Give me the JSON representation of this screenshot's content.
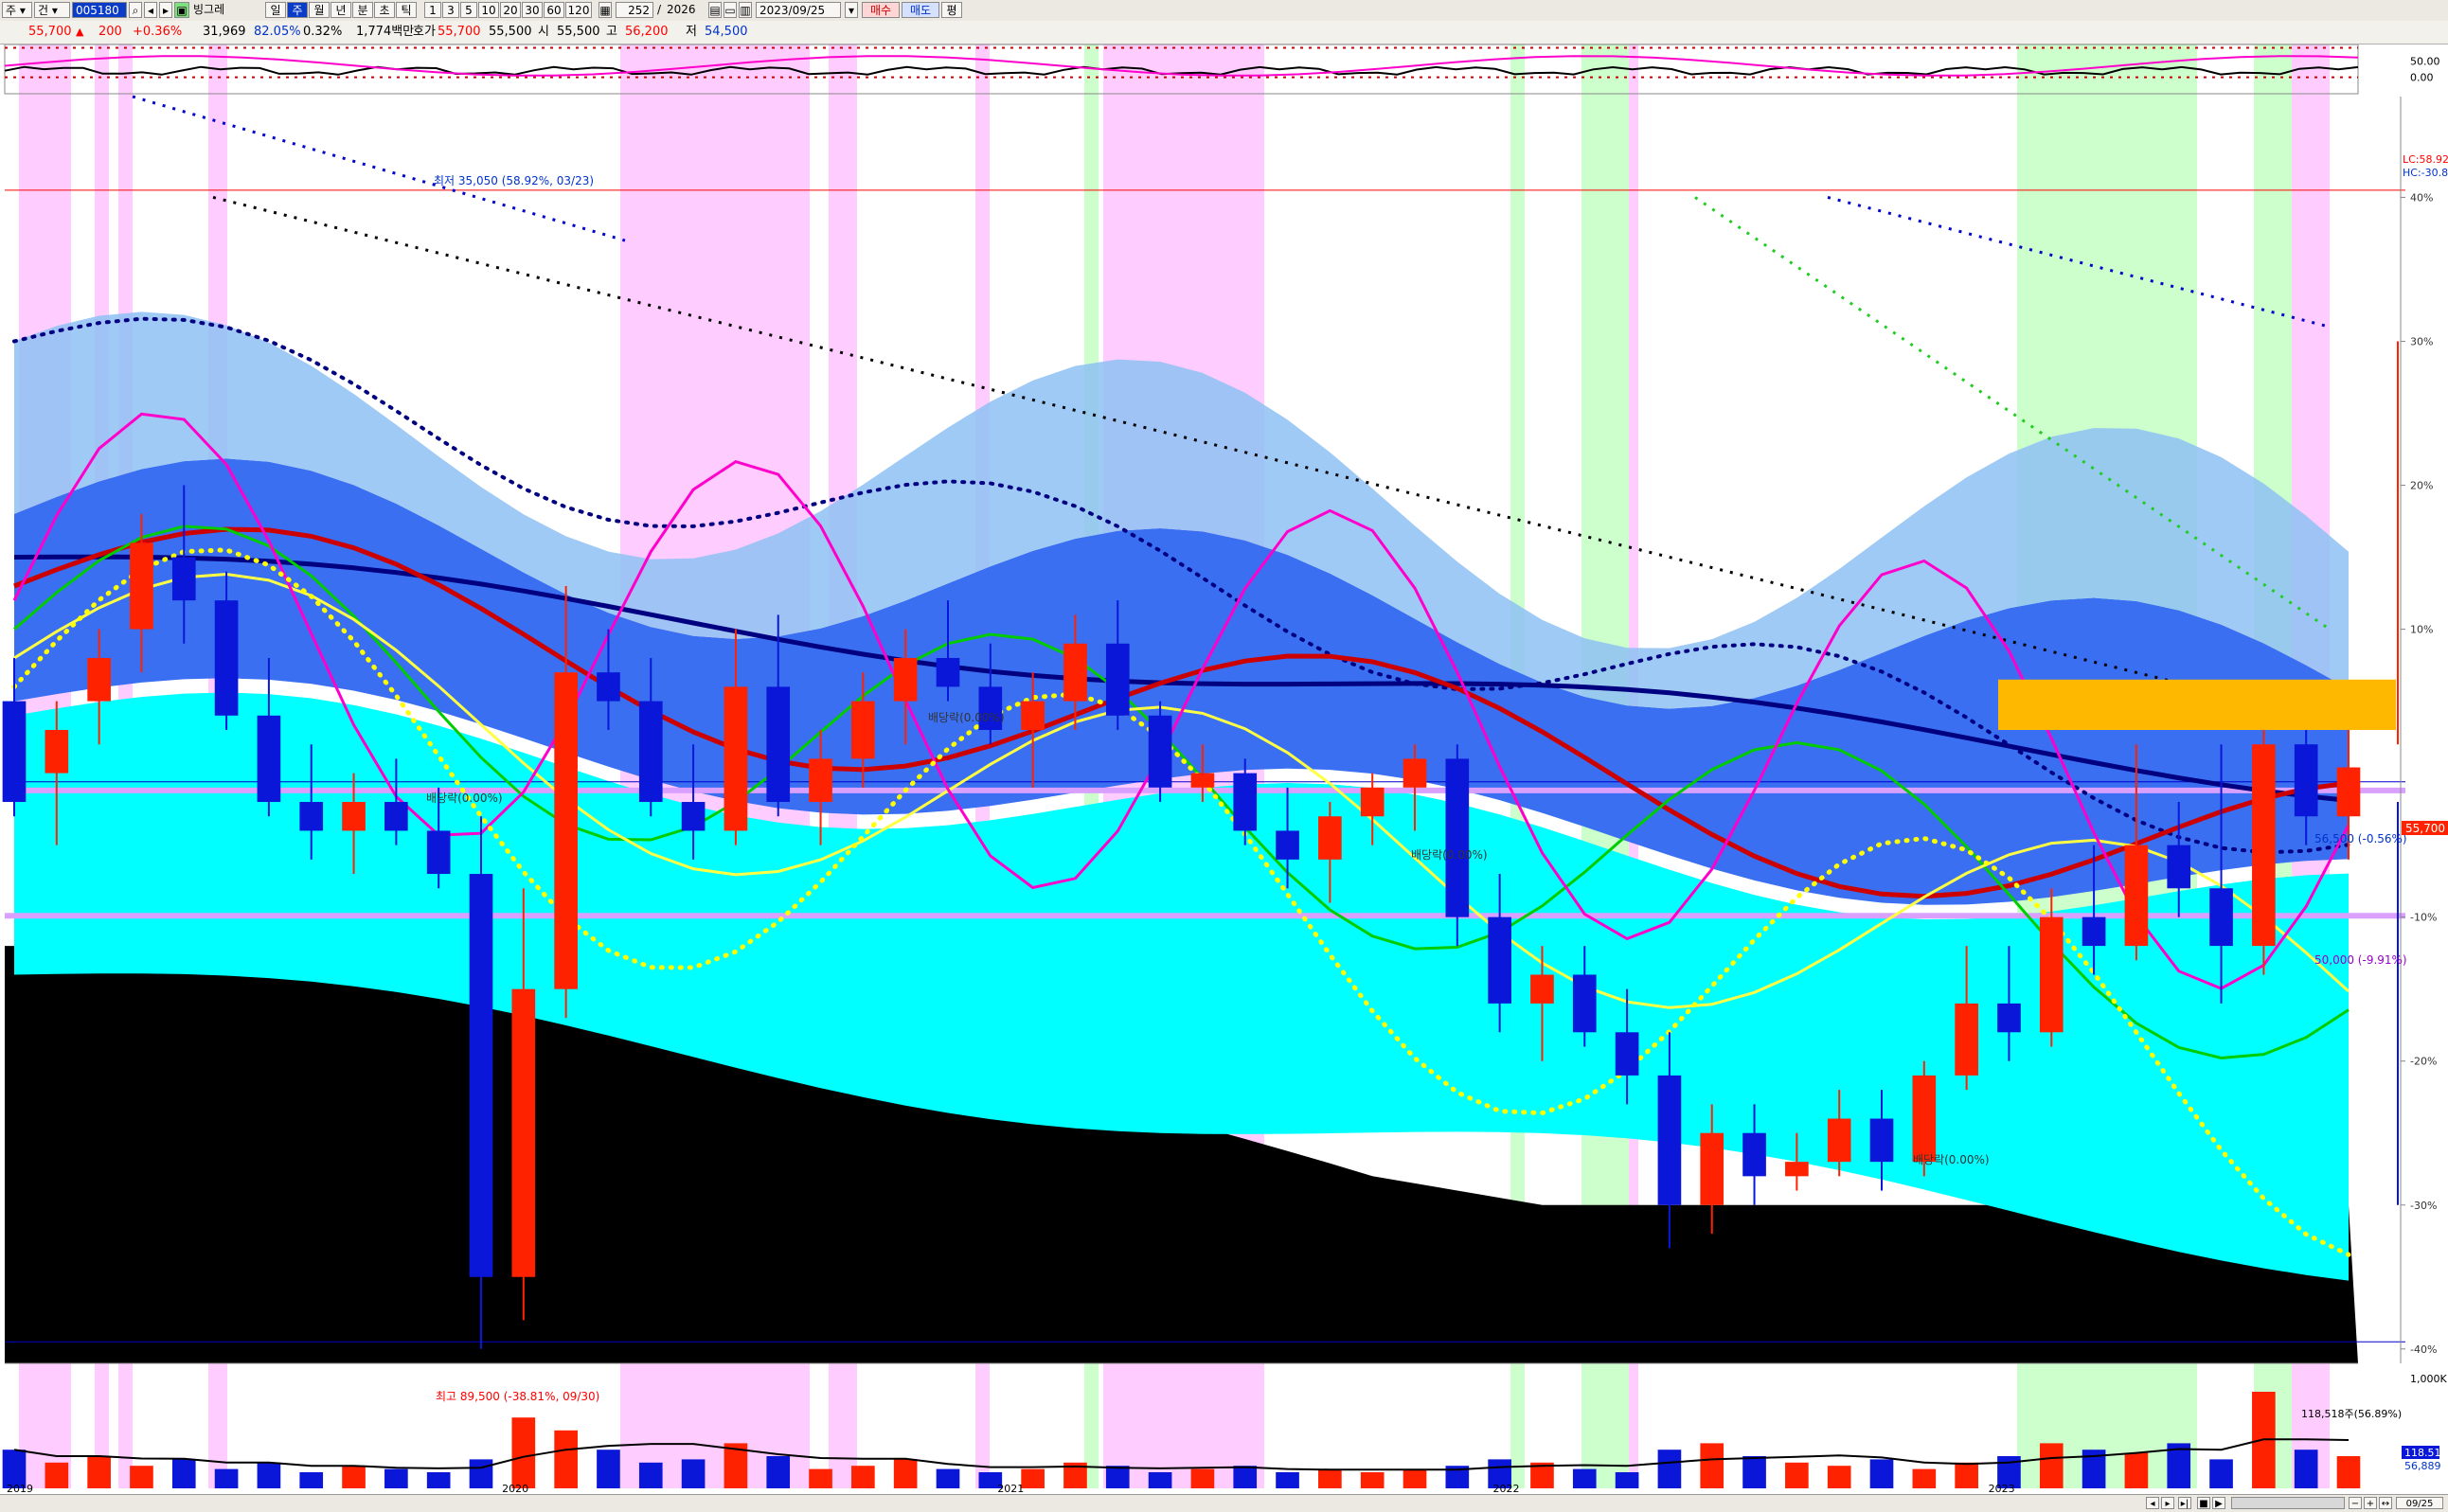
{
  "toolbar": {
    "market_label": "주",
    "item_label": "건",
    "code_value": "005180",
    "chart_name": "빙그레",
    "period_buttons": [
      "일",
      "주",
      "월",
      "년",
      "분",
      "초",
      "틱"
    ],
    "minute_buttons": [
      "1",
      "3",
      "5",
      "10",
      "20",
      "30",
      "60",
      "120"
    ],
    "count_value": "252",
    "count_total": "2026",
    "date_value": "2023/09/25",
    "buy_label": "매수",
    "sell_label": "매도",
    "extra_label": "평"
  },
  "quote": {
    "price": "55,700",
    "change_arrow": "▲",
    "change": "200",
    "change_pct": "+0.36%",
    "volume": "31,969",
    "volume_ratio": "82.05%",
    "turnover": "0.32%",
    "amount_label": "1,774백만",
    "ask_label": "호가",
    "ask_value": "55,700",
    "open_value": "55,500",
    "open_label": "시",
    "high_label": "고",
    "high_value": "56,200",
    "low_label": "저",
    "low_value": "54,500"
  },
  "colors": {
    "up": "#ff2200",
    "down": "#0a17d8",
    "ma_short": "#ff00cc",
    "ma_mid": "#00cc00",
    "ma_long": "#cc0000",
    "ma_year": "#000080",
    "cloud_top": "#3a6ff2",
    "cloud_light": "#8ec1f3",
    "cyan_band": "#00ffff",
    "bottom_band": "#000000",
    "green_bg": "#ccffcc",
    "pink_bg": "#ffccff",
    "dotted_yellow": "#ffff00"
  },
  "annotations": {
    "high_label": "최저 35,050 (58.92%, 03/23)",
    "low_label": "최고 89,500 (-38.81%, 09/30)",
    "ex_dividend_1": "배당락(0.00%)",
    "ex_dividend_2": "배당락(0.00%)",
    "ex_dividend_3": "배당락(0.00%)",
    "ex_dividend_4": "배당락(0.00%)",
    "cur_price_label": "55,700",
    "upper_line_label": "56,500 (-0.56%)",
    "lower_line_label": "50,000 (-9.91%)",
    "lc_label": "LC:58.92",
    "hc_label": "HC:-30.8",
    "vol_label": "118,518주(56.89%)",
    "vol_axis_value": "118.51",
    "vol_axis_value2": "56,889"
  },
  "chart_data": [
    {
      "type": "line",
      "name": "oscillator",
      "y_ticks": [
        "50.00",
        "0.00"
      ],
      "ylim": [
        -50,
        100
      ]
    },
    {
      "type": "candlestick",
      "name": "price",
      "x_labels": [
        "2019",
        "2020",
        "2021",
        "2022",
        "2023"
      ],
      "last_date_label": "09/25",
      "y_ticks": [
        "40%",
        "30%",
        "20%",
        "10%",
        "-10%",
        "-20%",
        "-30%",
        "-40%"
      ],
      "y_unit": "% from current price",
      "current_price": 55700,
      "ylim_pct": [
        -41,
        47
      ],
      "ohlc": [
        {
          "t": 0,
          "o": 5,
          "h": 8,
          "l": -3,
          "c": -2
        },
        {
          "t": 1,
          "o": 0,
          "h": 5,
          "l": -5,
          "c": 3
        },
        {
          "t": 2,
          "o": 5,
          "h": 10,
          "l": 2,
          "c": 8
        },
        {
          "t": 3,
          "o": 10,
          "h": 18,
          "l": 7,
          "c": 16
        },
        {
          "t": 4,
          "o": 15,
          "h": 20,
          "l": 9,
          "c": 12
        },
        {
          "t": 5,
          "o": 12,
          "h": 14,
          "l": 3,
          "c": 4
        },
        {
          "t": 6,
          "o": 4,
          "h": 8,
          "l": -3,
          "c": -2
        },
        {
          "t": 7,
          "o": -2,
          "h": 2,
          "l": -6,
          "c": -4
        },
        {
          "t": 8,
          "o": -4,
          "h": 0,
          "l": -7,
          "c": -2
        },
        {
          "t": 9,
          "o": -2,
          "h": 1,
          "l": -5,
          "c": -4
        },
        {
          "t": 10,
          "o": -4,
          "h": -1,
          "l": -8,
          "c": -7
        },
        {
          "t": 11,
          "o": -7,
          "h": -3,
          "l": -40,
          "c": -35
        },
        {
          "t": 12,
          "o": -35,
          "h": -8,
          "l": -38,
          "c": -15
        },
        {
          "t": 13,
          "o": -15,
          "h": 13,
          "l": -17,
          "c": 7
        },
        {
          "t": 14,
          "o": 7,
          "h": 10,
          "l": 3,
          "c": 5
        },
        {
          "t": 15,
          "o": 5,
          "h": 8,
          "l": -3,
          "c": -2
        },
        {
          "t": 16,
          "o": -2,
          "h": 2,
          "l": -6,
          "c": -4
        },
        {
          "t": 17,
          "o": -4,
          "h": 10,
          "l": -5,
          "c": 6
        },
        {
          "t": 18,
          "o": 6,
          "h": 11,
          "l": -3,
          "c": -2
        },
        {
          "t": 19,
          "o": -2,
          "h": 3,
          "l": -5,
          "c": 1
        },
        {
          "t": 20,
          "o": 1,
          "h": 7,
          "l": -1,
          "c": 5
        },
        {
          "t": 21,
          "o": 5,
          "h": 10,
          "l": 2,
          "c": 8
        },
        {
          "t": 22,
          "o": 8,
          "h": 12,
          "l": 5,
          "c": 6
        },
        {
          "t": 23,
          "o": 6,
          "h": 9,
          "l": 2,
          "c": 3
        },
        {
          "t": 24,
          "o": 3,
          "h": 7,
          "l": -1,
          "c": 5
        },
        {
          "t": 25,
          "o": 5,
          "h": 11,
          "l": 3,
          "c": 9
        },
        {
          "t": 26,
          "o": 9,
          "h": 12,
          "l": 3,
          "c": 4
        },
        {
          "t": 27,
          "o": 4,
          "h": 5,
          "l": -2,
          "c": -1
        },
        {
          "t": 28,
          "o": -1,
          "h": 2,
          "l": -2,
          "c": 0
        },
        {
          "t": 29,
          "o": 0,
          "h": 1,
          "l": -5,
          "c": -4
        },
        {
          "t": 30,
          "o": -4,
          "h": -1,
          "l": -8,
          "c": -6
        },
        {
          "t": 31,
          "o": -6,
          "h": -2,
          "l": -9,
          "c": -3
        },
        {
          "t": 32,
          "o": -3,
          "h": 0,
          "l": -5,
          "c": -1
        },
        {
          "t": 33,
          "o": -1,
          "h": 2,
          "l": -4,
          "c": 1
        },
        {
          "t": 34,
          "o": 1,
          "h": 2,
          "l": -12,
          "c": -10
        },
        {
          "t": 35,
          "o": -10,
          "h": -7,
          "l": -18,
          "c": -16
        },
        {
          "t": 36,
          "o": -16,
          "h": -12,
          "l": -20,
          "c": -14
        },
        {
          "t": 37,
          "o": -14,
          "h": -12,
          "l": -19,
          "c": -18
        },
        {
          "t": 38,
          "o": -18,
          "h": -15,
          "l": -23,
          "c": -21
        },
        {
          "t": 39,
          "o": -21,
          "h": -18,
          "l": -33,
          "c": -30
        },
        {
          "t": 40,
          "o": -30,
          "h": -23,
          "l": -32,
          "c": -25
        },
        {
          "t": 41,
          "o": -25,
          "h": -23,
          "l": -30,
          "c": -28
        },
        {
          "t": 42,
          "o": -28,
          "h": -25,
          "l": -29,
          "c": -27
        },
        {
          "t": 43,
          "o": -27,
          "h": -22,
          "l": -28,
          "c": -24
        },
        {
          "t": 44,
          "o": -24,
          "h": -22,
          "l": -29,
          "c": -27
        },
        {
          "t": 45,
          "o": -27,
          "h": -20,
          "l": -28,
          "c": -21
        },
        {
          "t": 46,
          "o": -21,
          "h": -12,
          "l": -22,
          "c": -16
        },
        {
          "t": 47,
          "o": -16,
          "h": -12,
          "l": -20,
          "c": -18
        },
        {
          "t": 48,
          "o": -18,
          "h": -8,
          "l": -19,
          "c": -10
        },
        {
          "t": 49,
          "o": -10,
          "h": -5,
          "l": -14,
          "c": -12
        },
        {
          "t": 50,
          "o": -12,
          "h": 2,
          "l": -13,
          "c": -5
        },
        {
          "t": 51,
          "o": -5,
          "h": -2,
          "l": -10,
          "c": -8
        },
        {
          "t": 52,
          "o": -8,
          "h": 2,
          "l": -16,
          "c": -12
        },
        {
          "t": 53,
          "o": -12,
          "h": 4,
          "l": -14,
          "c": 2
        },
        {
          "t": 54,
          "o": 2,
          "h": 4,
          "l": -5,
          "c": -3
        },
        {
          "t": 55,
          "o": -3,
          "h": 3,
          "l": -6,
          "c": 0.4
        }
      ]
    },
    {
      "type": "bar",
      "name": "volume",
      "y_ticks": [
        "1,000K"
      ],
      "values": [
        12,
        8,
        10,
        7,
        9,
        6,
        8,
        5,
        7,
        6,
        5,
        9,
        22,
        18,
        12,
        8,
        9,
        14,
        10,
        6,
        7,
        9,
        6,
        5,
        6,
        8,
        7,
        5,
        6,
        7,
        5,
        6,
        5,
        6,
        7,
        9,
        8,
        6,
        5,
        12,
        14,
        10,
        8,
        7,
        9,
        6,
        8,
        10,
        14,
        12,
        11,
        14,
        9,
        30,
        12,
        10
      ]
    }
  ]
}
